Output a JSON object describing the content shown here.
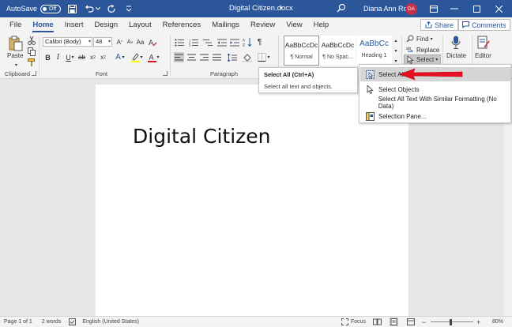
{
  "titlebar": {
    "autosave_label": "AutoSave",
    "autosave_state": "Off",
    "document_title": "Digital Citizen.docx",
    "title_caret": "▾",
    "user_name": "Diana Ann Roe",
    "avatar_initials": "DA"
  },
  "tabs": [
    {
      "label": "File"
    },
    {
      "label": "Home"
    },
    {
      "label": "Insert"
    },
    {
      "label": "Design"
    },
    {
      "label": "Layout"
    },
    {
      "label": "References"
    },
    {
      "label": "Mailings"
    },
    {
      "label": "Review"
    },
    {
      "label": "View"
    },
    {
      "label": "Help"
    }
  ],
  "share_label": "Share",
  "comments_label": "Comments",
  "ribbon": {
    "clipboard": {
      "paste_label": "Paste",
      "group_label": "Clipboard"
    },
    "font": {
      "font_name": "Calibri (Body)",
      "font_size": "48",
      "group_label": "Font"
    },
    "paragraph": {
      "group_label": "Paragraph"
    },
    "styles": {
      "items": [
        {
          "sample": "AaBbCcDc",
          "name": "¶ Normal"
        },
        {
          "sample": "AaBbCcDc",
          "name": "¶ No Spac..."
        },
        {
          "sample": "AaBbCc",
          "name": "Heading 1"
        }
      ]
    },
    "editing": {
      "find_label": "Find",
      "replace_label": "Replace",
      "select_label": "Select"
    },
    "voice": {
      "dictate_label": "Dictate"
    },
    "editor": {
      "editor_label": "Editor"
    }
  },
  "document": {
    "heading": "Digital Citizen"
  },
  "tooltip": {
    "title": "Select All (Ctrl+A)",
    "description": "Select all text and objects."
  },
  "select_menu": {
    "items": [
      {
        "label": "Select All"
      },
      {
        "label": "Select Objects"
      },
      {
        "label": "Select All Text With Similar Formatting (No Data)"
      },
      {
        "label": "Selection Pane..."
      }
    ]
  },
  "statusbar": {
    "page": "Page 1 of 1",
    "words": "2 words",
    "language": "English (United States)",
    "focus_label": "Focus",
    "zoom": "80%"
  },
  "colors": {
    "title_bar": "#2b579a",
    "accent": "#2b579a",
    "avatar": "#c4314b",
    "highlight_arrow": "#e81123"
  }
}
